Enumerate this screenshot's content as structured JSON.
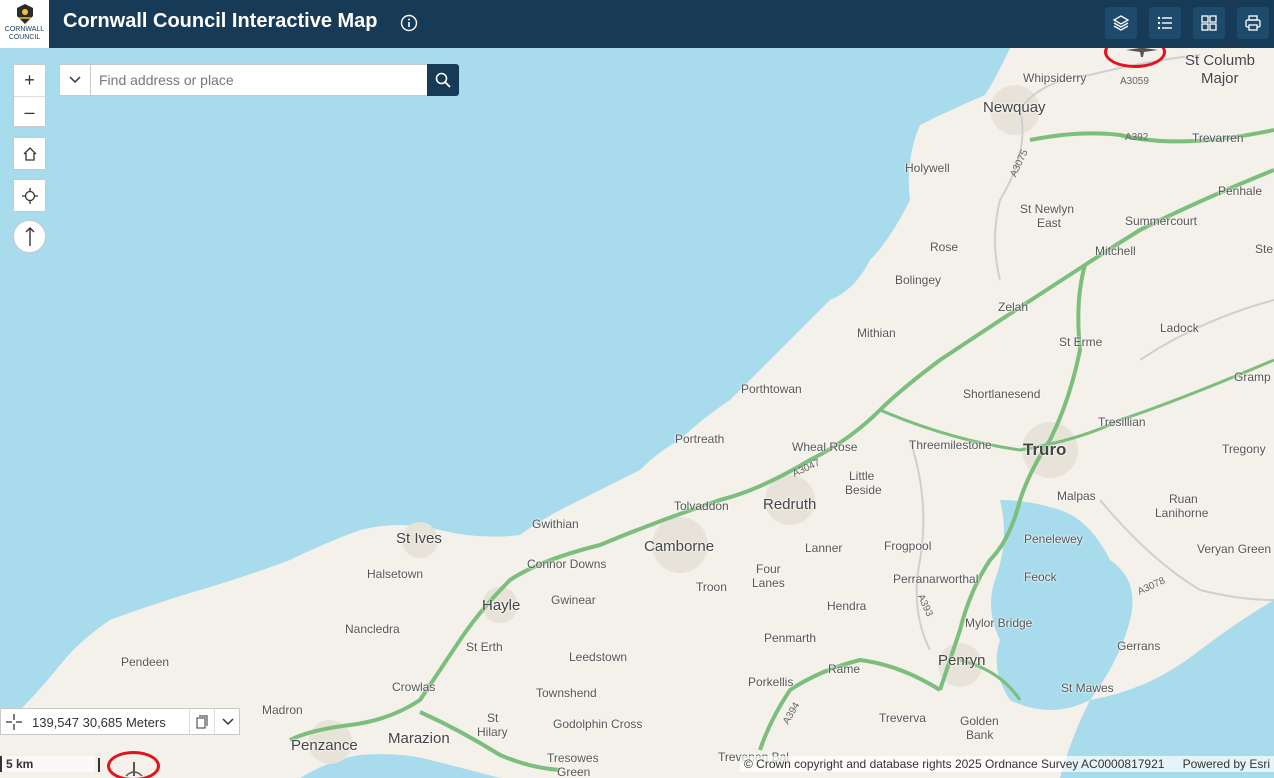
{
  "header": {
    "title": "Cornwall Council Interactive Map",
    "logo_line1": "CORNWALL",
    "logo_line2": "COUNCIL"
  },
  "icons": {
    "info": "info-icon",
    "layers": "layers-icon",
    "legend": "list-icon",
    "basemap": "grid-icon",
    "print": "print-icon"
  },
  "search": {
    "placeholder": "Find address or place"
  },
  "zoom": {
    "in": "+",
    "out": "–"
  },
  "coords": {
    "text": "139,547 30,685 Meters"
  },
  "scale": {
    "label": "5 km"
  },
  "attribution": {
    "text": "© Crown copyright and database rights 2025 Ordnance Survey AC0000817921",
    "powered": "Powered by Esri"
  },
  "places": {
    "st_columb": "St Columb",
    "major": "Major",
    "whipsiderry": "Whipsiderry",
    "newquay": "Newquay",
    "trevarren": "Trevarren",
    "holywell": "Holywell",
    "penhale": "Penhale",
    "st_newlyn": "St Newlyn",
    "east": "East",
    "summercourt": "Summercourt",
    "rose": "Rose",
    "mitchell": "Mitchell",
    "bolingey": "Bolingey",
    "zelah": "Zelah",
    "ladock": "Ladock",
    "mithian": "Mithian",
    "st_erme": "St Erme",
    "porthtowan": "Porthtowan",
    "shortlanesend": "Shortlanesend",
    "grampound": "Gramp",
    "portreath": "Portreath",
    "wheal_rose": "Wheal Rose",
    "threemilestone": "Threemilestone",
    "truro": "Truro",
    "tresillian": "Tresillian",
    "tregony": "Tregony",
    "little": "Little",
    "beside": "Beside",
    "tolvaddon": "Tolvaddon",
    "redruth": "Redruth",
    "malpas": "Malpas",
    "ruan": "Ruan",
    "lanihorne": "Lanihorne",
    "gwithian": "Gwithian",
    "st_ives": "St Ives",
    "camborne": "Camborne",
    "lanner": "Lanner",
    "frogpool": "Frogpool",
    "penelewey": "Penelewey",
    "veryan_green": "Veryan Green",
    "halsetown": "Halsetown",
    "connor_downs": "Connor Downs",
    "four": "Four",
    "lanes": "Lanes",
    "perranarworthal": "Perranarworthal",
    "feock": "Feock",
    "gwinear": "Gwinear",
    "troon": "Troon",
    "hayle": "Hayle",
    "hendra": "Hendra",
    "nancledra": "Nancledra",
    "mylor_bridge": "Mylor Bridge",
    "gerrans": "Gerrans",
    "st_erth": "St Erth",
    "penmarth": "Penmarth",
    "pendeen": "Pendeen",
    "leedstown": "Leedstown",
    "rame": "Rame",
    "penryn": "Penryn",
    "crowlas": "Crowlas",
    "porkellis": "Porkellis",
    "st_mawes": "St Mawes",
    "townshend": "Townshend",
    "madron": "Madron",
    "st": "St",
    "hilary": "Hilary",
    "godolphin_cross": "Godolphin Cross",
    "treverva": "Treverva",
    "golden": "Golden",
    "bank": "Bank",
    "penzance": "Penzance",
    "marazion": "Marazion",
    "tresowes": "Tresowes",
    "green": "Green",
    "trevenen_bal": "Trevenen Bal",
    "ste": "Ste"
  },
  "roads": {
    "a3059": "A3059",
    "a392": "A392",
    "a3075": "A3075",
    "a3047": "A3047",
    "a393": "A393",
    "a3078": "A3078",
    "a394": "A394"
  }
}
